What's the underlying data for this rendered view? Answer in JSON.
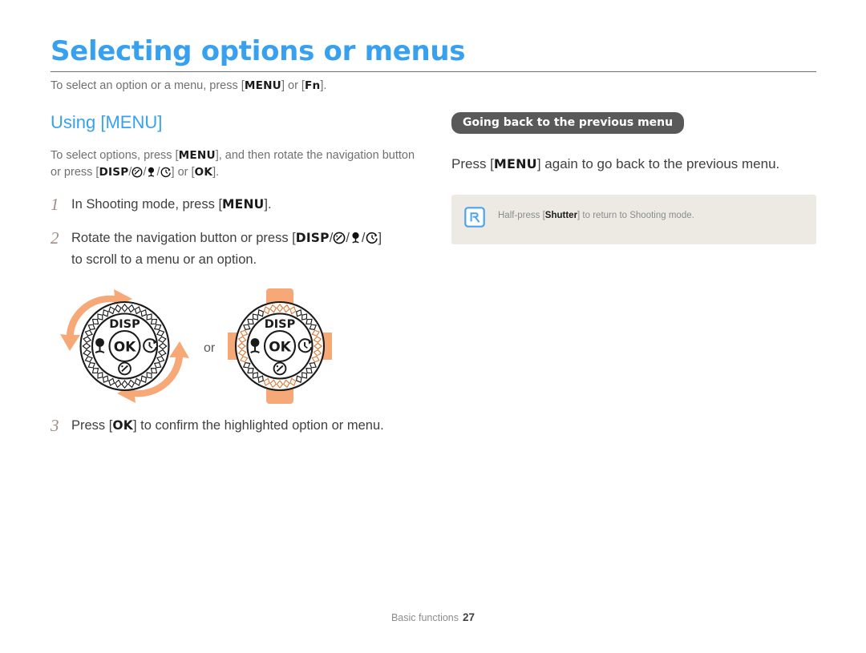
{
  "document": {
    "title": "Selecting options or menus",
    "intro_parts": [
      "To select an option or a menu, press [",
      "MENU",
      "] or [",
      "Fn",
      "]."
    ],
    "accent_blue": "#38a1ef",
    "rule_color": "#6d6e71",
    "step_number_color": "#a08d84",
    "orange": "#f5a97c",
    "note_bg": "#edeae3"
  },
  "left_column": {
    "subheading": "Using [MENU]",
    "paragraph": {
      "part1": "To select options, press [",
      "key1": "MENU",
      "part2": "], and then rotate the navigation button or press [",
      "key2": "DISP",
      "sep1": "/",
      "icon1": "exposure-icon",
      "sep2": "/",
      "icon2": "macro-icon",
      "sep3": "/",
      "icon3": "timer-icon",
      "part3": "] or [",
      "key3": "OK",
      "part4": "]."
    },
    "steps": [
      {
        "number": "1",
        "text_part1": "In Shooting mode, press [",
        "key": "MENU",
        "text_part2": "]."
      },
      {
        "number": "2",
        "text_part1": "Rotate the navigation button or press [",
        "key": "DISP",
        "icons": [
          "exposure-icon",
          "macro-icon",
          "timer-icon"
        ],
        "text_part2": "]",
        "text_line2": "to scroll to a menu or an option."
      },
      {
        "number": "3",
        "text_part1": "Press [",
        "key": "OK",
        "text_part2": "] to confirm the highlighted option or menu."
      }
    ],
    "figure": {
      "or_label": "or",
      "dial_left": {
        "name": "navigation-dial-rotate",
        "disp_label": "DISP",
        "ok_label": "OK",
        "buttons": [
          "macro-icon",
          "timer-icon",
          "exposure-icon"
        ],
        "annotation": "rotate-arrows"
      },
      "dial_right": {
        "name": "navigation-dial-press",
        "disp_label": "DISP",
        "ok_label": "OK",
        "buttons": [
          "macro-icon",
          "timer-icon",
          "exposure-icon"
        ],
        "annotation": "press-highlights"
      }
    }
  },
  "right_column": {
    "pill_label": "Going back to the previous menu",
    "paragraph": {
      "part1": "Press [",
      "key": "MENU",
      "part2": "] again to go back to the previous menu."
    },
    "note": {
      "icon": "note-pen-icon",
      "part1": "Half-press [",
      "key": "Shutter",
      "part2": "] to return to Shooting mode."
    }
  },
  "footer": {
    "section": "Basic functions",
    "page_number": "27"
  }
}
